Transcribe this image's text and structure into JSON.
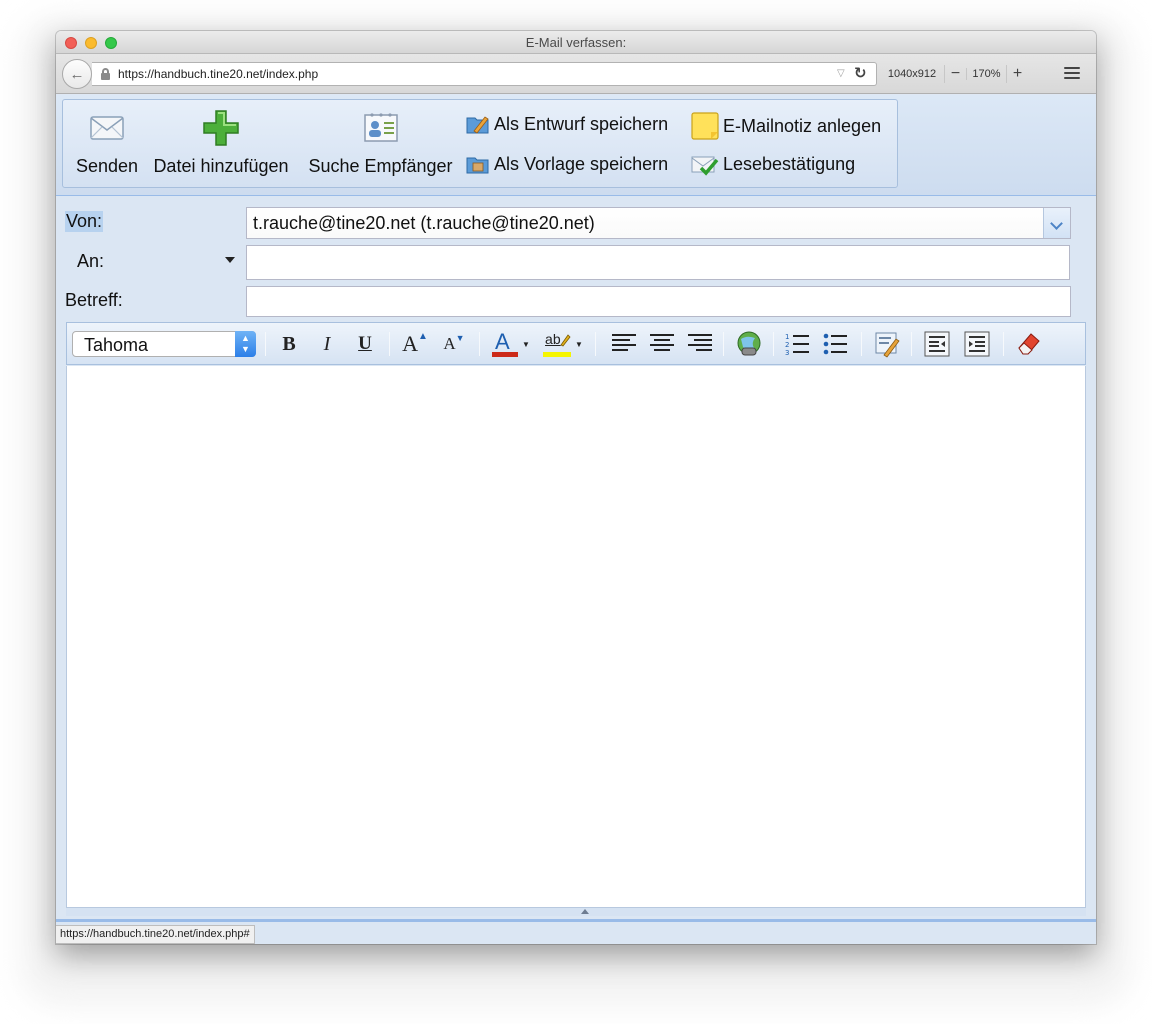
{
  "window": {
    "title": "E-Mail verfassen:"
  },
  "browser": {
    "url": "https://handbuch.tine20.net/index.php",
    "window_size": "1040x912",
    "zoom": "170%",
    "zoom_out": "−",
    "zoom_in": "+",
    "status_url": "https://handbuch.tine20.net/index.php#"
  },
  "toolbar": {
    "send_label": "Senden",
    "attach_label": "Datei hinzufügen",
    "search_label": "Suche Empfänger",
    "save_draft_label": "Als Entwurf speichern",
    "save_template_label": "Als Vorlage speichern",
    "note_label": "E-Mailnotiz anlegen",
    "receipt_label": "Lesebestätigung"
  },
  "form": {
    "from_label": "Von:",
    "from_value": "t.rauche@tine20.net (t.rauche@tine20.net)",
    "to_label": "An:",
    "to_value": "",
    "subject_label": "Betreff:",
    "subject_value": ""
  },
  "editor": {
    "font": "Tahoma",
    "bold": "B",
    "italic": "I",
    "underline": "U",
    "grow": "A",
    "shrink": "A",
    "fore_color": "A",
    "highlight": "ab",
    "font_color_hex": "#cc2a1a",
    "highlight_hex": "#f5f500"
  }
}
